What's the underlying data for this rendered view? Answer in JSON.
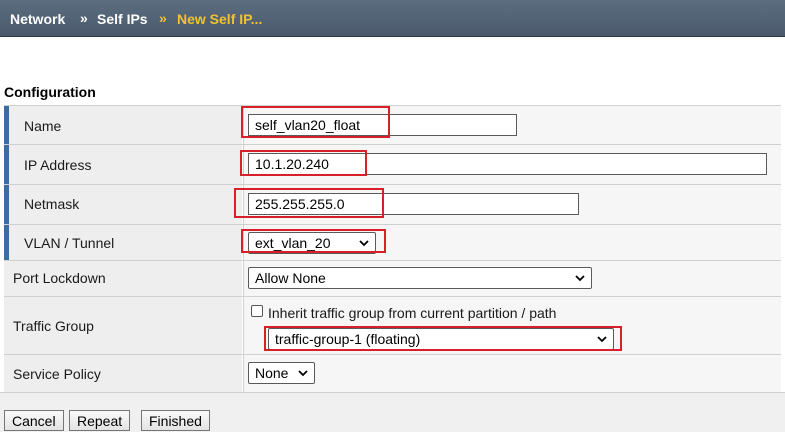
{
  "breadcrumb": {
    "items": [
      "Network",
      "Self IPs",
      "New Self IP..."
    ],
    "separator": "»",
    "current_color": "#f2c12e"
  },
  "section_title": "Configuration",
  "form": {
    "name": {
      "label": "Name",
      "value": "self_vlan20_float"
    },
    "ip_address": {
      "label": "IP Address",
      "value": "10.1.20.240"
    },
    "netmask": {
      "label": "Netmask",
      "value": "255.255.255.0"
    },
    "vlan_tunnel": {
      "label": "VLAN / Tunnel",
      "value": "ext_vlan_20"
    },
    "port_lockdown": {
      "label": "Port Lockdown",
      "value": "Allow None"
    },
    "traffic_group": {
      "label": "Traffic Group",
      "inherit_label": "Inherit traffic group from current partition / path",
      "inherit_checked": false,
      "value": "traffic-group-1 (floating)"
    },
    "service_policy": {
      "label": "Service Policy",
      "value": "None"
    }
  },
  "buttons": {
    "cancel": "Cancel",
    "repeat": "Repeat",
    "finished": "Finished"
  },
  "colors": {
    "header_bg": "#4a5a6c",
    "highlight": "#d91f2a",
    "required_marker": "#3a6ba3"
  }
}
